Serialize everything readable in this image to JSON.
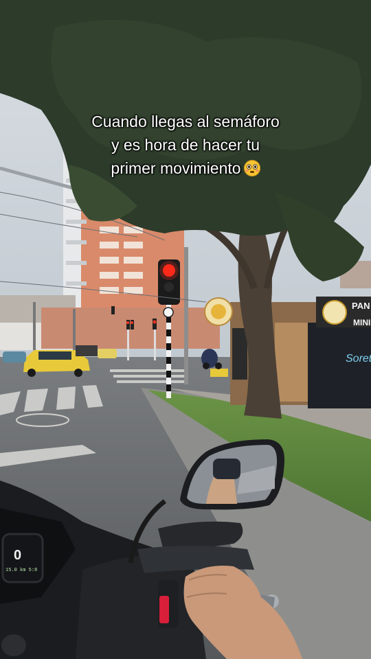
{
  "caption": {
    "line1": "Cuando llegas al semáforo",
    "line2": "y es hora de hacer tu",
    "line3": "primer movimiento",
    "emoji": "flushed-face-emoji"
  },
  "storefront": {
    "sign_line1": "PAN",
    "sign_line2": "MINI",
    "graffiti": "Sorete"
  },
  "dashboard": {
    "speed": "0",
    "readout": "15.0 km 5:8"
  },
  "colors": {
    "sky": "#cfd6dc",
    "tree": "#2c3b2a",
    "taxi": "#e8c93a",
    "traffic_light_red": "#ff2a1a",
    "building": "#d98a6a",
    "road": "#6b6f74",
    "grass": "#5f8a3c"
  }
}
